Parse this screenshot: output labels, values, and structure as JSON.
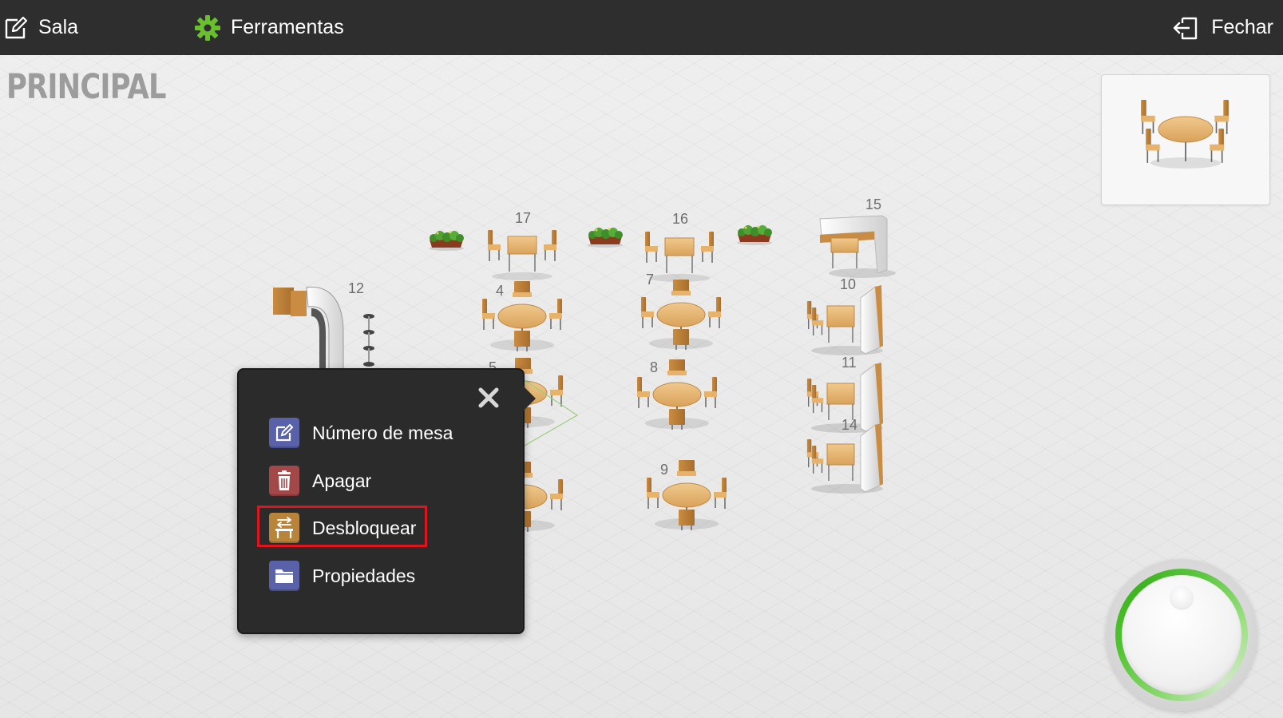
{
  "topbar": {
    "sala_label": "Sala",
    "tools_label": "Ferramentas",
    "close_label": "Fechar",
    "background": "#2e2e2e",
    "gear_color": "#6abf2e"
  },
  "room": {
    "title": "PRINCIPAL"
  },
  "tables": {
    "t4": "4",
    "t5": "5",
    "t7": "7",
    "t8": "8",
    "t9": "9",
    "t10": "10",
    "t11": "11",
    "t12": "12",
    "t14": "14",
    "t15": "15",
    "t16": "16",
    "t17": "17"
  },
  "context_menu": {
    "items": [
      {
        "label": "Número de mesa",
        "icon": "edit-icon",
        "color": "#5961a8"
      },
      {
        "label": "Apagar",
        "icon": "trash-icon",
        "color": "#a24848"
      },
      {
        "label": "Desbloquear",
        "icon": "unlock-table-icon",
        "color": "#b8843a"
      },
      {
        "label": "Propiedades",
        "icon": "folder-icon",
        "color": "#5961a8"
      }
    ],
    "highlighted_item": "Desbloquear",
    "highlight_color": "#e0141e"
  },
  "preview": {
    "icon": "round-table-4-chairs-icon"
  },
  "joystick": {
    "ring_color": "#4fc22f"
  }
}
